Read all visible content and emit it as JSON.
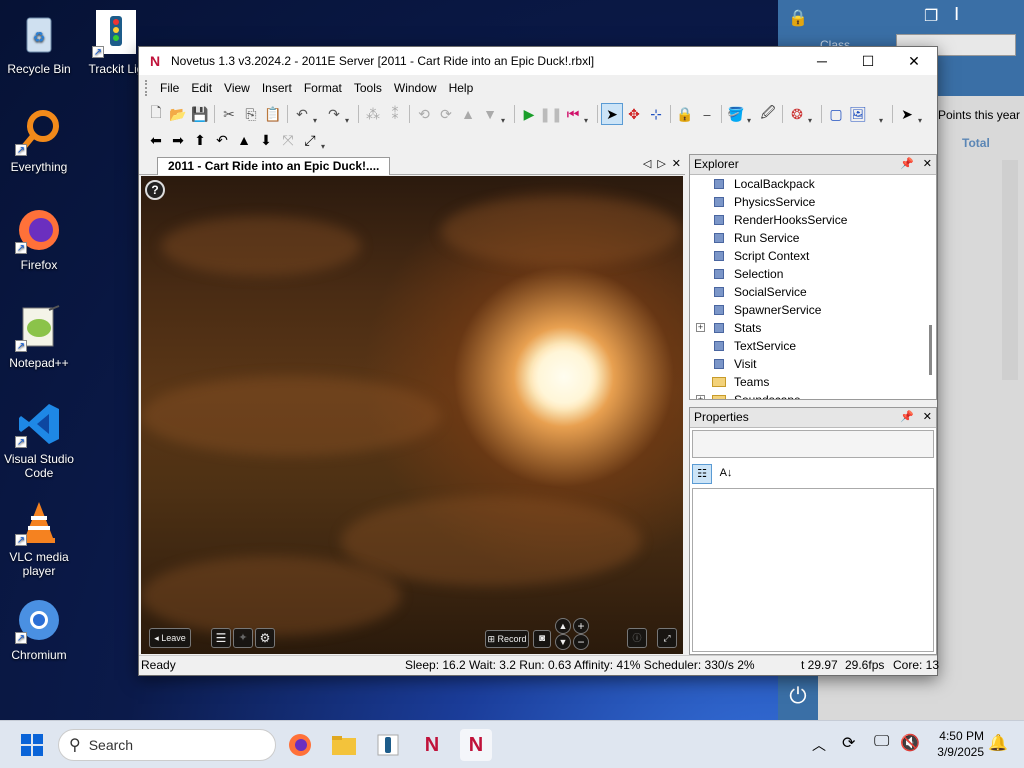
{
  "desktop": {
    "icons": [
      {
        "label": "Recycle Bin",
        "icon": "recycle-bin-icon"
      },
      {
        "label": "Trackit Lig",
        "icon": "trackit-icon"
      },
      {
        "label": "Everything",
        "icon": "everything-search-icon"
      },
      {
        "label": "Firefox",
        "icon": "firefox-icon"
      },
      {
        "label": "Notepad++",
        "icon": "notepad-plus-icon"
      },
      {
        "label": "Visual Studio Code",
        "icon": "vscode-icon"
      },
      {
        "label": "VLC media player",
        "icon": "vlc-icon"
      },
      {
        "label": "Chromium",
        "icon": "chromium-icon"
      }
    ]
  },
  "bg_window": {
    "label_class": "Class",
    "points_label": "Points this year",
    "total_label": "Total"
  },
  "window": {
    "title": "Novetus 1.3 v3.2024.2 - 2011E Server [2011 - Cart Ride into an Epic Duck!.rbxl]",
    "app_icon_letter": "N",
    "menu": [
      "File",
      "Edit",
      "View",
      "Insert",
      "Format",
      "Tools",
      "Window",
      "Help"
    ],
    "doc_tab": "2011 - Cart Ride into an Epic Duck!....",
    "viewport": {
      "help": "?",
      "leave": "Leave",
      "record": "Record"
    },
    "explorer": {
      "title": "Explorer",
      "items": [
        {
          "label": "LocalBackpack",
          "expand": false,
          "kind": "service"
        },
        {
          "label": "PhysicsService",
          "expand": false,
          "kind": "service"
        },
        {
          "label": "RenderHooksService",
          "expand": false,
          "kind": "service"
        },
        {
          "label": "Run Service",
          "expand": false,
          "kind": "service"
        },
        {
          "label": "Script Context",
          "expand": false,
          "kind": "service"
        },
        {
          "label": "Selection",
          "expand": false,
          "kind": "service"
        },
        {
          "label": "SocialService",
          "expand": false,
          "kind": "service"
        },
        {
          "label": "SpawnerService",
          "expand": false,
          "kind": "service"
        },
        {
          "label": "Stats",
          "expand": true,
          "kind": "service"
        },
        {
          "label": "TextService",
          "expand": false,
          "kind": "service"
        },
        {
          "label": "Visit",
          "expand": false,
          "kind": "service"
        },
        {
          "label": "Teams",
          "expand": false,
          "kind": "folder"
        },
        {
          "label": "Soundscape",
          "expand": true,
          "kind": "folder"
        }
      ]
    },
    "properties": {
      "title": "Properties"
    },
    "status": {
      "ready": "Ready",
      "perf": "Sleep: 16.2 Wait: 3.2 Run: 0.63 Affinity: 41% Scheduler: 330/s 2%",
      "time": "t 29.97",
      "fps": "29.6fps",
      "cores": "Core: 13"
    }
  },
  "taskbar": {
    "search_placeholder": "Search",
    "time": "4:50 PM",
    "date": "3/9/2025"
  }
}
